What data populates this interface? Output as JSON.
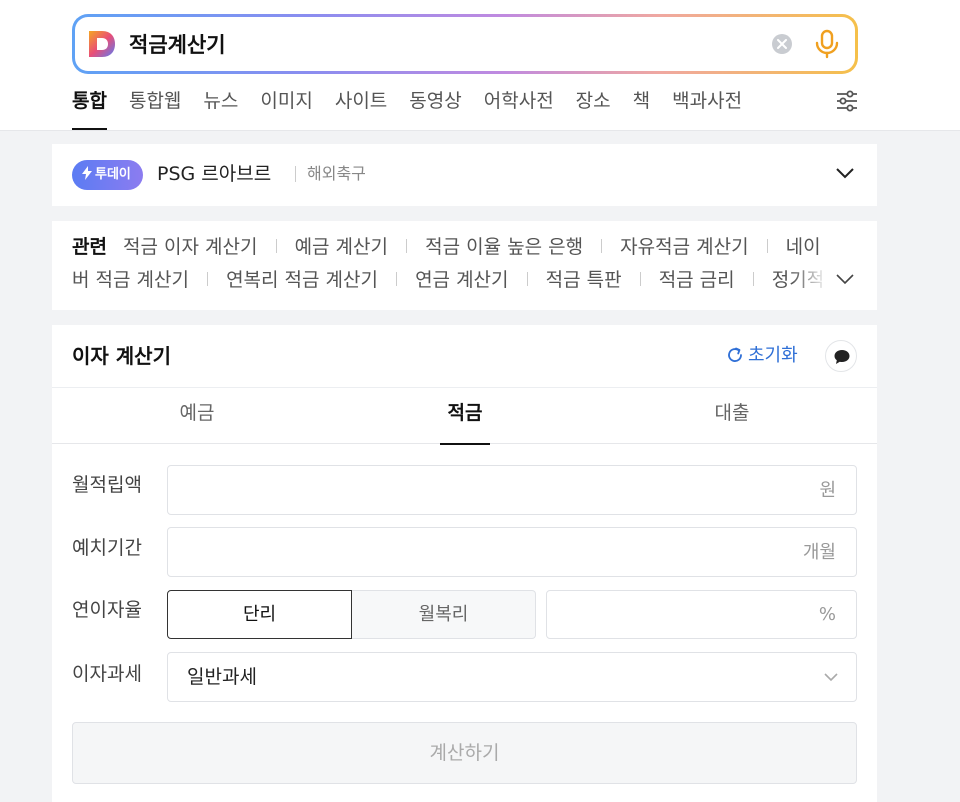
{
  "search": {
    "query": "적금계산기"
  },
  "tabs": [
    {
      "label": "통합",
      "active": true
    },
    {
      "label": "통합웹"
    },
    {
      "label": "뉴스"
    },
    {
      "label": "이미지"
    },
    {
      "label": "사이트"
    },
    {
      "label": "동영상"
    },
    {
      "label": "어학사전"
    },
    {
      "label": "장소"
    },
    {
      "label": "책"
    },
    {
      "label": "백과사전"
    }
  ],
  "today": {
    "badge": "투데이",
    "title": "PSG 르아브르",
    "category": "해외축구"
  },
  "related": {
    "label": "관련",
    "line1": [
      "적금 이자 계산기",
      "예금 계산기",
      "적금 이율 높은 은행",
      "자유적금 계산기",
      "네이"
    ],
    "line2": [
      "버 적금 계산기",
      "연복리 적금 계산기",
      "연금 계산기",
      "적금 특판",
      "적금 금리",
      "정기적"
    ]
  },
  "calculator": {
    "title": "이자 계산기",
    "reset_label": "초기화",
    "tabs": [
      "예금",
      "적금",
      "대출"
    ],
    "active_tab": "적금",
    "fields": {
      "monthly_label": "월적립액",
      "monthly_unit": "원",
      "period_label": "예치기간",
      "period_unit": "개월",
      "rate_label": "연이자율",
      "rate_simple": "단리",
      "rate_compound": "월복리",
      "rate_unit": "%",
      "tax_label": "이자과세",
      "tax_value": "일반과세"
    },
    "submit_label": "계산하기"
  },
  "colors": {
    "accent_blue": "#2f6fd6",
    "badge_gradient_start": "#5b7cf3"
  }
}
